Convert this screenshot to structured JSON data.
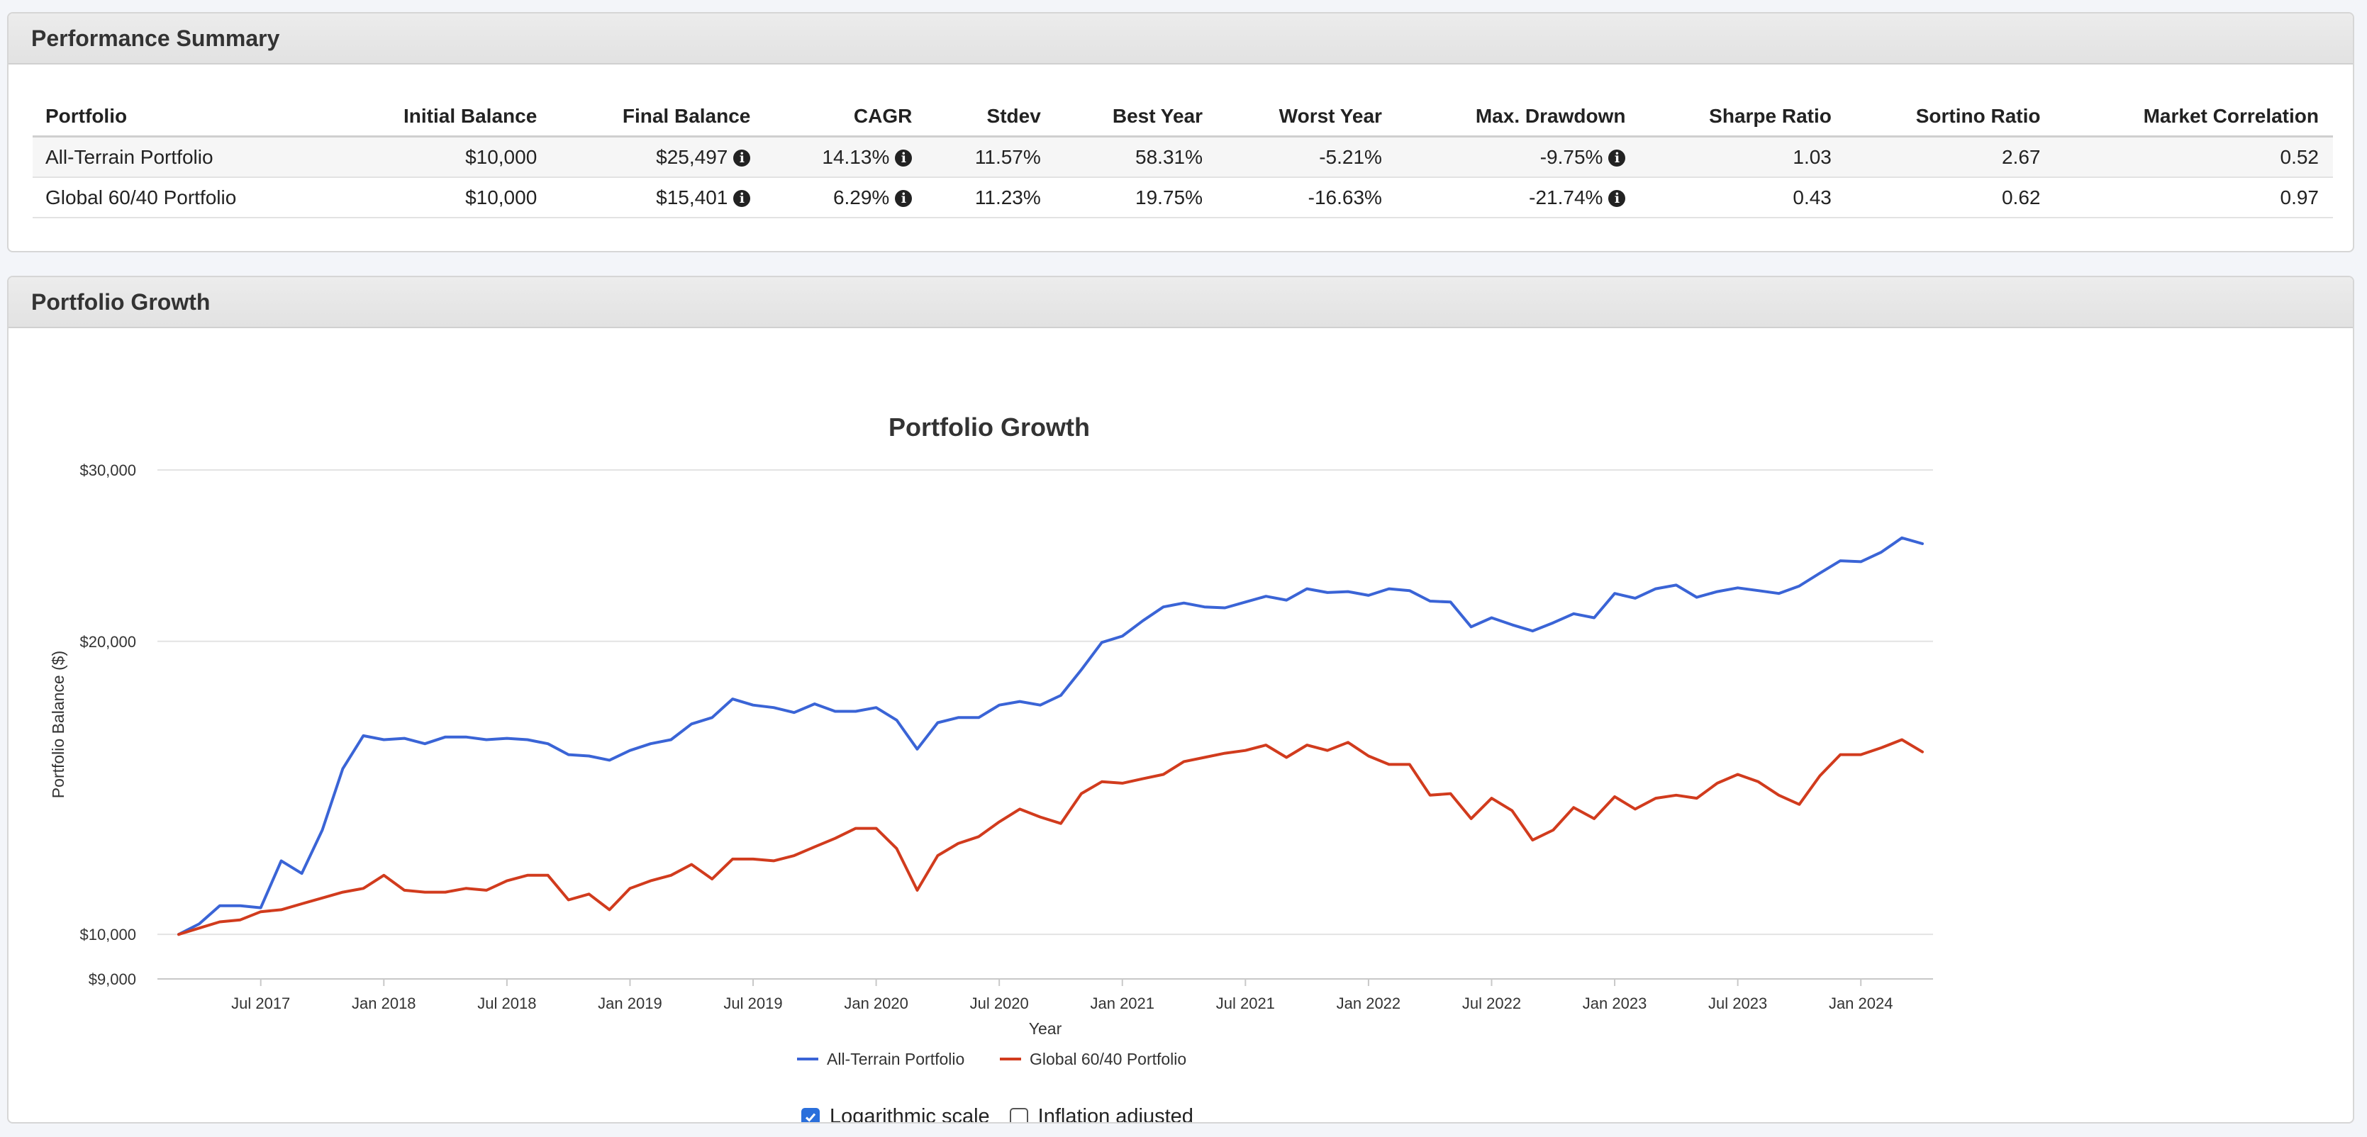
{
  "summary": {
    "title": "Performance Summary",
    "columns": [
      "Portfolio",
      "Initial Balance",
      "Final Balance",
      "CAGR",
      "Stdev",
      "Best Year",
      "Worst Year",
      "Max. Drawdown",
      "Sharpe Ratio",
      "Sortino Ratio",
      "Market Correlation"
    ],
    "rows": [
      {
        "portfolio": "All-Terrain Portfolio",
        "initial": "$10,000",
        "final": "$25,497",
        "cagr": "14.13%",
        "stdev": "11.57%",
        "best": "58.31%",
        "worst": "-5.21%",
        "maxdd": "-9.75%",
        "sharpe": "1.03",
        "sortino": "2.67",
        "corr": "0.52"
      },
      {
        "portfolio": "Global 60/40 Portfolio",
        "initial": "$10,000",
        "final": "$15,401",
        "cagr": "6.29%",
        "stdev": "11.23%",
        "best": "19.75%",
        "worst": "-16.63%",
        "maxdd": "-21.74%",
        "sharpe": "0.43",
        "sortino": "0.62",
        "corr": "0.97"
      }
    ],
    "info_icon": "info-circle-icon"
  },
  "growth": {
    "title": "Portfolio Growth",
    "log_label": "Logarithmic scale",
    "log_checked": true,
    "inflation_label": "Inflation adjusted",
    "inflation_checked": false
  },
  "chart_data": {
    "type": "line",
    "title": "Portfolio Growth",
    "xlabel": "Year",
    "ylabel": "Portfolio Balance ($)",
    "y_scale": "log",
    "ylim": [
      9000,
      30000
    ],
    "y_ticks": [
      9000,
      10000,
      20000,
      30000
    ],
    "y_tick_labels": [
      "$9,000",
      "$10,000",
      "$20,000",
      "$30,000"
    ],
    "x_ticks": [
      "Jul 2017",
      "Jan 2018",
      "Jul 2018",
      "Jan 2019",
      "Jul 2019",
      "Jan 2020",
      "Jul 2020",
      "Jan 2021",
      "Jul 2021",
      "Jan 2022",
      "Jul 2022",
      "Jan 2023",
      "Jul 2023",
      "Jan 2024"
    ],
    "x_start": "2017-03",
    "grid": true,
    "legend_position": "bottom",
    "series": [
      {
        "name": "All-Terrain Portfolio",
        "color": "#3a64d6",
        "values": [
          10000,
          10250,
          10700,
          10700,
          10650,
          11900,
          11550,
          12800,
          14800,
          16000,
          15850,
          15900,
          15700,
          15950,
          15950,
          15850,
          15900,
          15850,
          15700,
          15300,
          15250,
          15100,
          15450,
          15700,
          15850,
          16450,
          16700,
          17450,
          17200,
          17100,
          16900,
          17250,
          16950,
          16950,
          17100,
          16600,
          15500,
          16500,
          16700,
          16700,
          17200,
          17350,
          17200,
          17600,
          18700,
          19950,
          20250,
          21000,
          21700,
          21900,
          21700,
          21650,
          21950,
          22250,
          22050,
          22650,
          22450,
          22500,
          22300,
          22650,
          22550,
          22000,
          21950,
          20700,
          21150,
          20800,
          20500,
          20900,
          21350,
          21150,
          22400,
          22150,
          22650,
          22850,
          22200,
          22500,
          22700,
          22550,
          22400,
          22800,
          23500,
          24200,
          24150,
          24700,
          25550,
          25200
        ]
      },
      {
        "name": "Global 60/40 Portfolio",
        "color": "#d13b1d",
        "values": [
          10000,
          10150,
          10300,
          10350,
          10550,
          10600,
          10750,
          10900,
          11050,
          11150,
          11500,
          11100,
          11050,
          11050,
          11150,
          11100,
          11350,
          11500,
          11500,
          10850,
          11000,
          10600,
          11150,
          11350,
          11500,
          11800,
          11400,
          11950,
          11950,
          11900,
          12050,
          12300,
          12550,
          12850,
          12850,
          12250,
          11100,
          12050,
          12400,
          12600,
          13050,
          13450,
          13200,
          13000,
          13950,
          14350,
          14300,
          14450,
          14600,
          15050,
          15200,
          15350,
          15450,
          15650,
          15200,
          15650,
          15450,
          15750,
          15250,
          14950,
          14950,
          13900,
          13950,
          13150,
          13800,
          13400,
          12500,
          12800,
          13500,
          13150,
          13850,
          13450,
          13800,
          13900,
          13800,
          14300,
          14600,
          14350,
          13900,
          13600,
          14550,
          15300,
          15300,
          15550,
          15850,
          15400
        ]
      }
    ]
  }
}
